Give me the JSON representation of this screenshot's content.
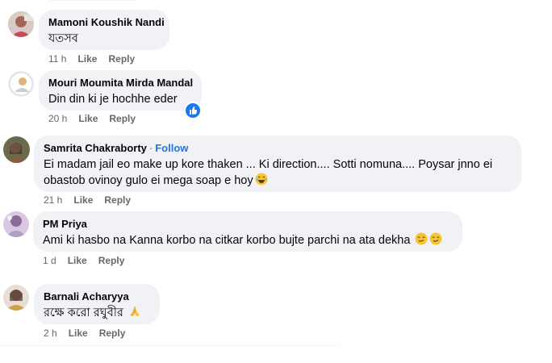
{
  "colors": {
    "bubble_bg": "#f0f2f5",
    "meta_text": "#65676b",
    "link_blue": "#1877f2"
  },
  "comments": [
    {
      "author": "Mamoni Koushik Nandi",
      "text": "যতসব",
      "time": "11 h",
      "like_label": "Like",
      "reply_label": "Reply"
    },
    {
      "author": "Mouri Moumita Mirda Mandal",
      "text": "Din din ki je hochhe eder",
      "time": "20 h",
      "like_label": "Like",
      "reply_label": "Reply",
      "reaction_icon": "thumbs-up-icon"
    },
    {
      "author": "Samrita Chakraborty",
      "follow_label": "Follow",
      "text_line1": "Ei madam jail eo make up kore thaken ... Ki direction.... Sotti nomuna.... Poysar jnno ei",
      "text_line2": "obastob ovinoy gulo ei mega soap e hoy",
      "emoji": "laughing-emoji",
      "time": "21 h",
      "like_label": "Like",
      "reply_label": "Reply"
    },
    {
      "author": "PM Priya",
      "text": "Ami ki hasbo na Kanna korbo na citkar korbo bujte parchi na ata dekha",
      "emoji": "smirk-emoji",
      "time": "1 d",
      "like_label": "Like",
      "reply_label": "Reply"
    },
    {
      "author": "Barnali Acharyya",
      "text": "রক্ষে করো রঘুবীর",
      "emoji": "praying-hands-emoji",
      "time": "2 h",
      "like_label": "Like",
      "reply_label": "Reply"
    }
  ]
}
